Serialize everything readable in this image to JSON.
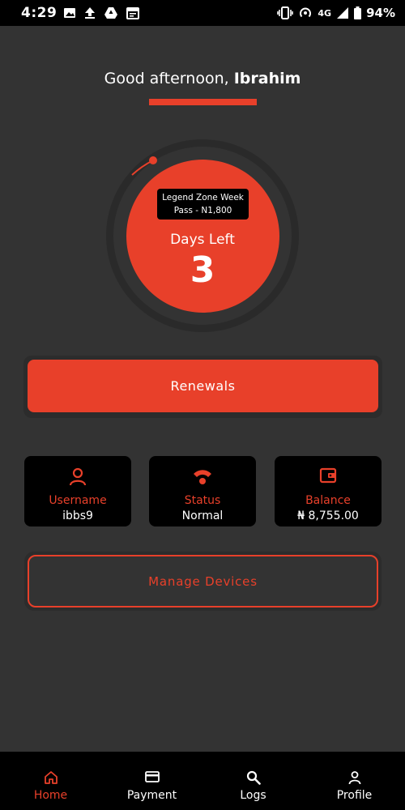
{
  "status_bar": {
    "time": "4:29",
    "network": "4G",
    "battery": "94%"
  },
  "colors": {
    "accent": "#e8402a",
    "background": "#333333",
    "card": "#000000"
  },
  "greeting": {
    "prefix": "Good afternoon, ",
    "name": "Ibrahim"
  },
  "plan": {
    "name_line1": "Legend Zone Week",
    "name_line2": "Pass - N1,800",
    "days_label": "Days Left",
    "days_value": "3"
  },
  "renewals_label": "Renewals",
  "cards": [
    {
      "icon": "user-icon",
      "label": "Username",
      "value": "ibbs9"
    },
    {
      "icon": "signal-icon",
      "label": "Status",
      "value": "Normal"
    },
    {
      "icon": "wallet-icon",
      "label": "Balance",
      "value": "₦ 8,755.00"
    }
  ],
  "manage_devices_label": "Manage Devices",
  "nav": [
    {
      "icon": "home-icon",
      "label": "Home",
      "active": true
    },
    {
      "icon": "card-icon",
      "label": "Payment",
      "active": false
    },
    {
      "icon": "search-icon",
      "label": "Logs",
      "active": false
    },
    {
      "icon": "person-icon",
      "label": "Profile",
      "active": false
    }
  ]
}
